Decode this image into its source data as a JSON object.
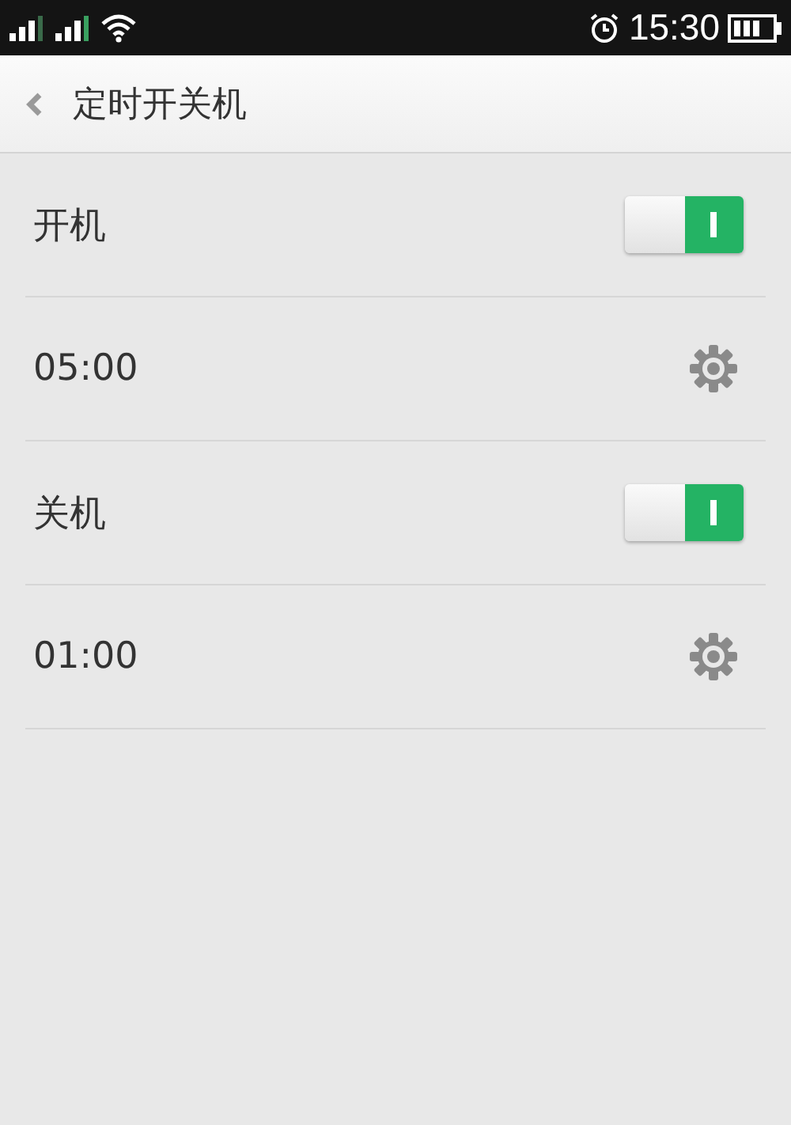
{
  "status_bar": {
    "time": "15:30"
  },
  "header": {
    "title": "定时开关机"
  },
  "rows": [
    {
      "kind": "switch",
      "label": "开机",
      "on": true
    },
    {
      "kind": "time",
      "label": "05:00"
    },
    {
      "kind": "switch",
      "label": "关机",
      "on": true
    },
    {
      "kind": "time",
      "label": "01:00"
    }
  ]
}
